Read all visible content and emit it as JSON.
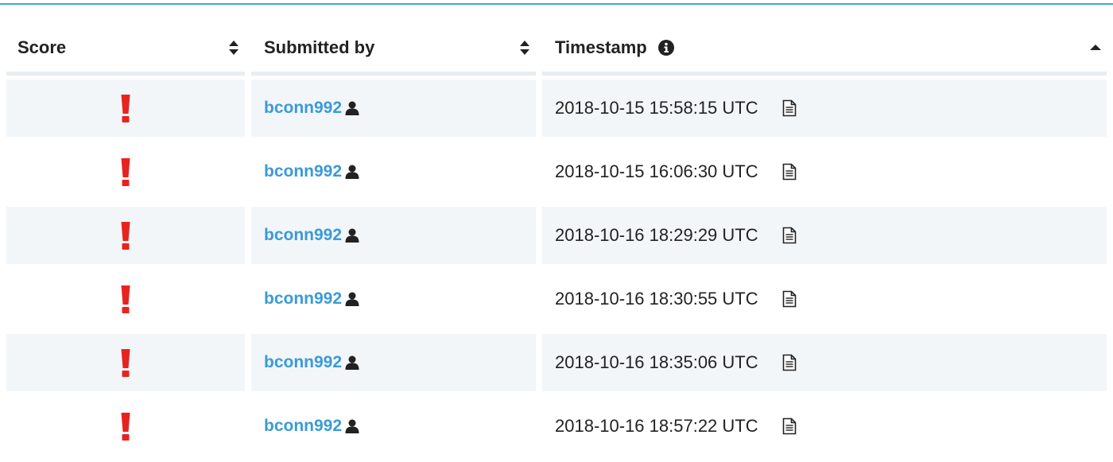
{
  "columns": {
    "score": "Score",
    "submitted_by": "Submitted by",
    "timestamp": "Timestamp"
  },
  "icons": {
    "score_sort": "sort-icon",
    "submitted_sort": "sort-icon",
    "timestamp_info": "info-icon",
    "timestamp_sort": "sort-ascending-icon",
    "score_value": "exclamation-icon",
    "user": "user-icon",
    "log": "document-icon"
  },
  "colors": {
    "accent": "#3fa9dd",
    "link": "#3a9ad9",
    "error": "#e8231f",
    "row_shade": "#f2f6f9"
  },
  "rows": [
    {
      "user": "bconn992",
      "timestamp": "2018-10-15 15:58:15 UTC"
    },
    {
      "user": "bconn992",
      "timestamp": "2018-10-15 16:06:30 UTC"
    },
    {
      "user": "bconn992",
      "timestamp": "2018-10-16 18:29:29 UTC"
    },
    {
      "user": "bconn992",
      "timestamp": "2018-10-16 18:30:55 UTC"
    },
    {
      "user": "bconn992",
      "timestamp": "2018-10-16 18:35:06 UTC"
    },
    {
      "user": "bconn992",
      "timestamp": "2018-10-16 18:57:22 UTC"
    }
  ]
}
